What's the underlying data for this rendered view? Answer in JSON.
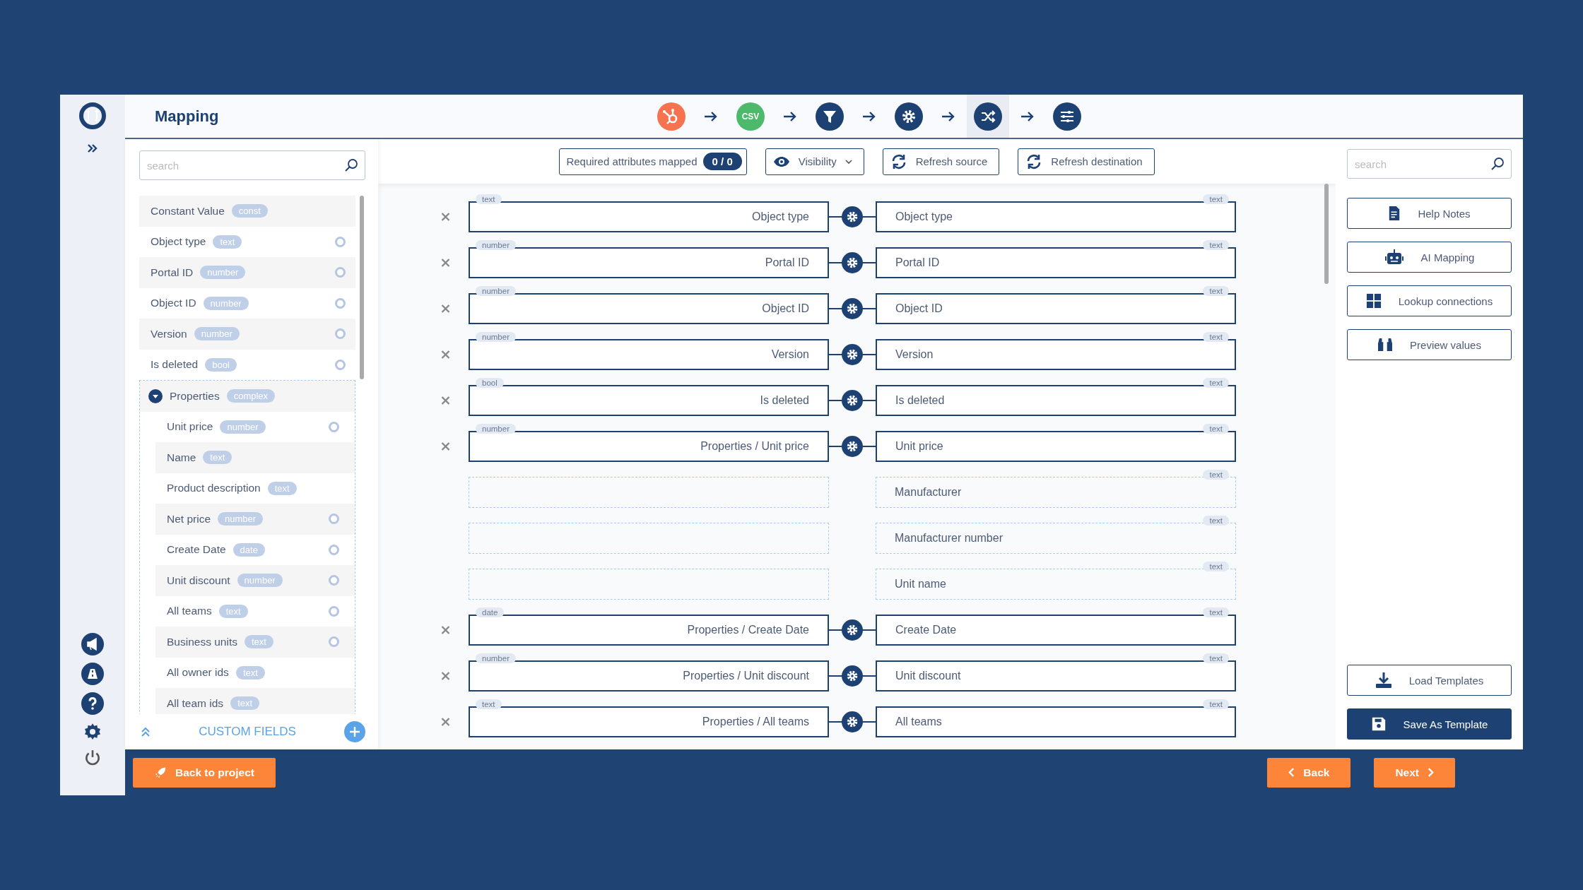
{
  "header": {
    "title": "Mapping",
    "steps": [
      {
        "kind": "hubspot",
        "selected": false
      },
      {
        "kind": "csv",
        "label": "CSV",
        "selected": false
      },
      {
        "kind": "filter",
        "selected": false
      },
      {
        "kind": "settings",
        "selected": false
      },
      {
        "kind": "shuffle",
        "selected": true
      },
      {
        "kind": "sliders",
        "selected": false
      }
    ]
  },
  "source_panel": {
    "search": {
      "placeholder": "search"
    },
    "fields": [
      {
        "label": "Constant Value",
        "type": "const",
        "linked": false
      },
      {
        "label": "Object type",
        "type": "text",
        "linked": true
      },
      {
        "label": "Portal ID",
        "type": "number",
        "linked": true
      },
      {
        "label": "Object ID",
        "type": "number",
        "linked": true
      },
      {
        "label": "Version",
        "type": "number",
        "linked": true
      },
      {
        "label": "Is deleted",
        "type": "bool",
        "linked": true
      },
      {
        "label": "Properties",
        "type": "complex",
        "linked": false,
        "expanded": true,
        "children": [
          {
            "label": "Unit price",
            "type": "number",
            "linked": true
          },
          {
            "label": "Name",
            "type": "text",
            "linked": false
          },
          {
            "label": "Product description",
            "type": "text",
            "linked": false
          },
          {
            "label": "Net price",
            "type": "number",
            "linked": true
          },
          {
            "label": "Create Date",
            "type": "date",
            "linked": true
          },
          {
            "label": "Unit discount",
            "type": "number",
            "linked": true
          },
          {
            "label": "All teams",
            "type": "text",
            "linked": true
          },
          {
            "label": "Business units",
            "type": "text",
            "linked": true
          },
          {
            "label": "All owner ids",
            "type": "text",
            "linked": false
          },
          {
            "label": "All team ids",
            "type": "text",
            "linked": false
          }
        ]
      }
    ],
    "custom_fields": "CUSTOM FIELDS"
  },
  "toolbar": {
    "required_label": "Required attributes mapped",
    "required_count": "0 / 0",
    "visibility": "Visibility",
    "refresh_source": "Refresh source",
    "refresh_destination": "Refresh destination"
  },
  "mappings": [
    {
      "kind": "mapped",
      "source": {
        "type": "text",
        "label": "Object type"
      },
      "target": {
        "type": "text",
        "label": "Object type"
      }
    },
    {
      "kind": "mapped",
      "source": {
        "type": "number",
        "label": "Portal ID"
      },
      "target": {
        "type": "text",
        "label": "Portal ID"
      }
    },
    {
      "kind": "mapped",
      "source": {
        "type": "number",
        "label": "Object ID"
      },
      "target": {
        "type": "text",
        "label": "Object ID"
      }
    },
    {
      "kind": "mapped",
      "source": {
        "type": "number",
        "label": "Version"
      },
      "target": {
        "type": "text",
        "label": "Version"
      }
    },
    {
      "kind": "mapped",
      "source": {
        "type": "bool",
        "label": "Is deleted"
      },
      "target": {
        "type": "text",
        "label": "Is deleted"
      }
    },
    {
      "kind": "mapped",
      "source": {
        "type": "number",
        "label": "Properties / Unit price"
      },
      "target": {
        "type": "text",
        "label": "Unit price"
      }
    },
    {
      "kind": "empty",
      "target": {
        "type": "text",
        "label": "Manufacturer"
      }
    },
    {
      "kind": "empty",
      "target": {
        "type": "text",
        "label": "Manufacturer number"
      }
    },
    {
      "kind": "empty",
      "target": {
        "type": "text",
        "label": "Unit name"
      }
    },
    {
      "kind": "mapped",
      "source": {
        "type": "date",
        "label": "Properties / Create Date"
      },
      "target": {
        "type": "text",
        "label": "Create Date"
      }
    },
    {
      "kind": "mapped",
      "source": {
        "type": "number",
        "label": "Properties / Unit discount"
      },
      "target": {
        "type": "text",
        "label": "Unit discount"
      }
    },
    {
      "kind": "mapped",
      "source": {
        "type": "text",
        "label": "Properties / All teams"
      },
      "target": {
        "type": "text",
        "label": "All teams"
      }
    }
  ],
  "tools_panel": {
    "search": {
      "placeholder": "search"
    },
    "tools": [
      {
        "kind": "notes",
        "label": "Help Notes"
      },
      {
        "kind": "robot",
        "label": "AI Mapping"
      },
      {
        "kind": "grid",
        "label": "Lookup connections"
      },
      {
        "kind": "binoculars",
        "label": "Preview values"
      }
    ],
    "templates": [
      {
        "kind": "download",
        "label": "Load Templates",
        "primary": false
      },
      {
        "kind": "save",
        "label": "Save As Template",
        "primary": true
      }
    ]
  },
  "footer": {
    "back_to_project": "Back to project",
    "back": "Back",
    "next": "Next"
  }
}
